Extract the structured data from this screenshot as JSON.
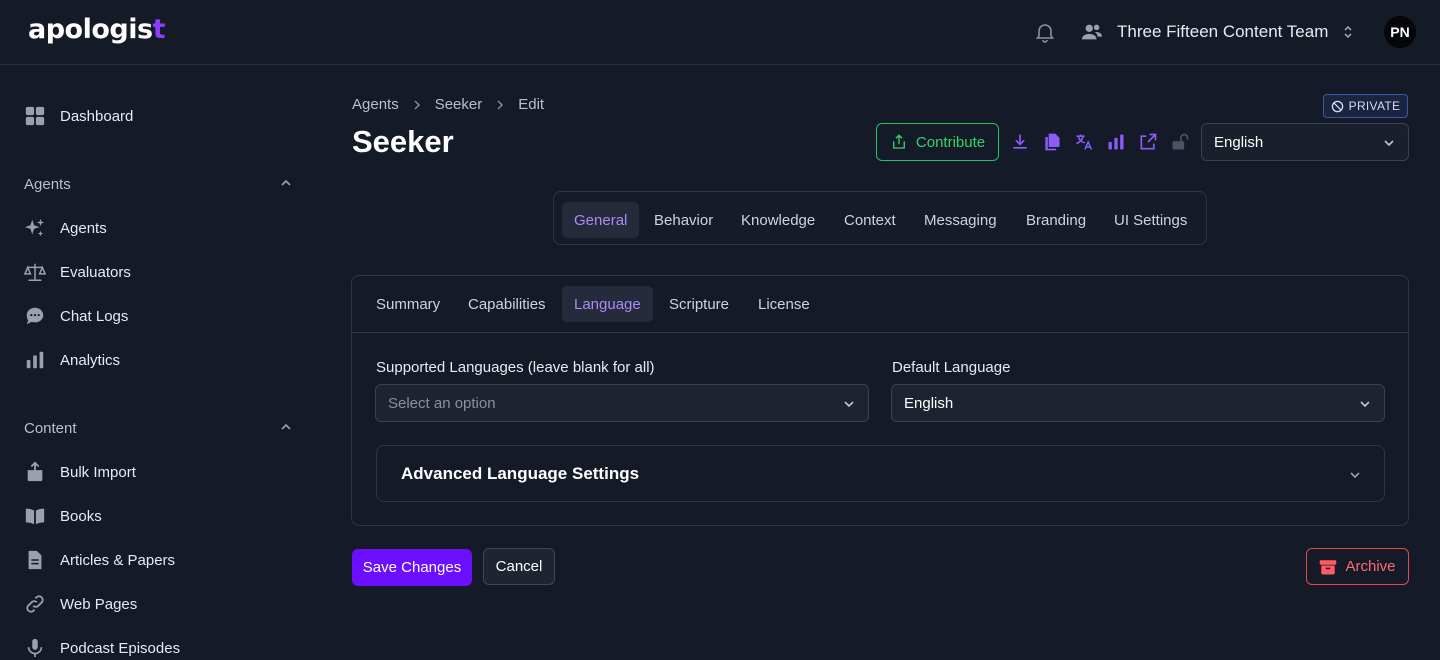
{
  "header": {
    "logo": "apologis",
    "logo_mark": "t",
    "team_name": "Three Fifteen Content Team",
    "avatar_initials": "PN"
  },
  "sidebar": {
    "dashboard": "Dashboard",
    "agents_section": "Agents",
    "agents_items": [
      "Agents",
      "Evaluators",
      "Chat Logs",
      "Analytics"
    ],
    "content_section": "Content",
    "content_items": [
      "Bulk Import",
      "Books",
      "Articles & Papers",
      "Web Pages",
      "Podcast Episodes"
    ]
  },
  "breadcrumb": [
    "Agents",
    "Seeker",
    "Edit"
  ],
  "page": {
    "title": "Seeker",
    "visibility_badge": "PRIVATE",
    "contribute_label": "Contribute",
    "language_selector": "English"
  },
  "main_tabs": [
    "General",
    "Behavior",
    "Knowledge",
    "Context",
    "Messaging",
    "Branding",
    "UI Settings"
  ],
  "active_main_tab": "General",
  "sub_tabs": [
    "Summary",
    "Capabilities",
    "Language",
    "Scripture",
    "License"
  ],
  "active_sub_tab": "Language",
  "form": {
    "supported_languages_label": "Supported Languages (leave blank for all)",
    "supported_languages_placeholder": "Select an option",
    "default_language_label": "Default Language",
    "default_language_value": "English",
    "advanced_title": "Advanced Language Settings"
  },
  "actions": {
    "save": "Save Changes",
    "cancel": "Cancel",
    "archive": "Archive"
  },
  "colors": {
    "accent": "#8b3cff",
    "contribute": "#22c55e",
    "danger": "#e5484d",
    "active_tab_text": "#a78bfa"
  }
}
